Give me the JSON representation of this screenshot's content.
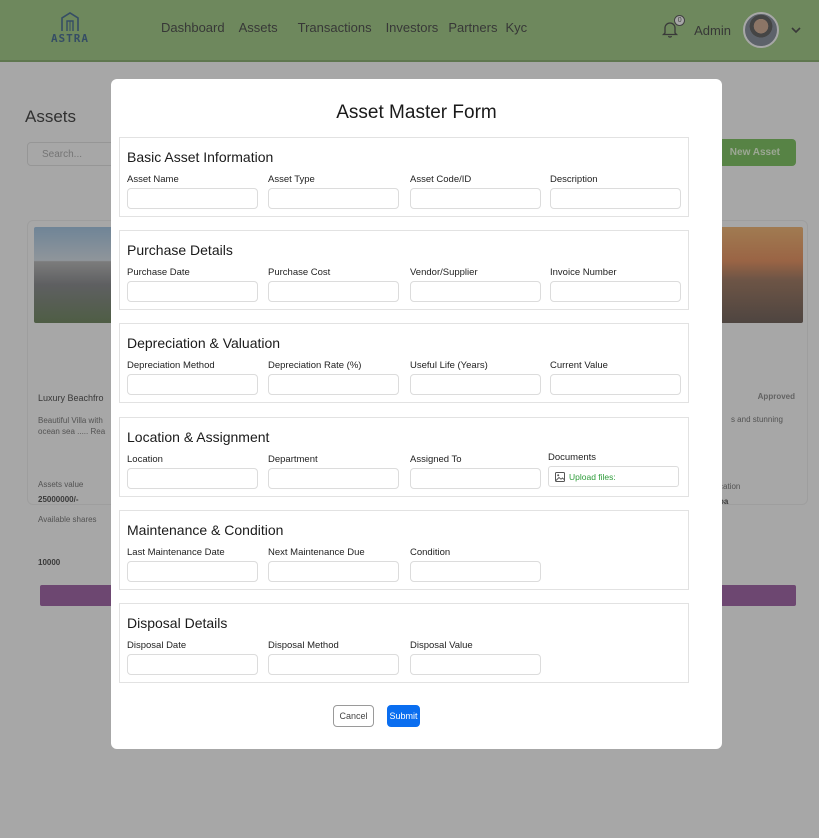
{
  "navbar": {
    "logo_text": "ASTRA",
    "links": [
      "Dashboard",
      "Assets",
      "Transactions",
      "Investors",
      "Partners",
      "Kyc"
    ],
    "notifications_badge": "0",
    "user_label": "Admin"
  },
  "page": {
    "title": "Assets",
    "search_placeholder": "Search...",
    "new_asset_label": "New Asset"
  },
  "background_cards": {
    "left": {
      "title": "Luxury Beachfro",
      "description": "Beautiful Villa with ocean sea ..... Rea",
      "assets_value_label": "Assets value",
      "assets_value": "25000000/-",
      "available_shares_label": "Available shares",
      "available_shares": "10000"
    },
    "right": {
      "status": "Approved",
      "description": "s and stunning",
      "location_label": "cation",
      "location_value": "oa"
    }
  },
  "modal": {
    "title": "Asset Master Form",
    "sections": [
      {
        "title": "Basic Asset Information",
        "fields": [
          "Asset Name",
          "Asset Type",
          "Asset Code/ID",
          "Description"
        ]
      },
      {
        "title": "Purchase Details",
        "fields": [
          "Purchase Date",
          "Purchase Cost",
          "Vendor/Supplier",
          "Invoice Number"
        ]
      },
      {
        "title": "Depreciation & Valuation",
        "fields": [
          "Depreciation Method",
          "Depreciation Rate (%)",
          "Useful Life (Years)",
          "Current Value"
        ]
      },
      {
        "title": "Location & Assignment",
        "fields": [
          "Location",
          "Department",
          "Assigned To"
        ],
        "documents_label": "Documents",
        "upload_label": "Upload files:"
      },
      {
        "title": "Maintenance & Condition",
        "fields": [
          "Last Maintenance Date",
          "Next Maintenance Due",
          "Condition"
        ]
      },
      {
        "title": "Disposal Details",
        "fields": [
          "Disposal Date",
          "Disposal Method",
          "Disposal Value"
        ]
      }
    ],
    "cancel_label": "Cancel",
    "submit_label": "Submit"
  },
  "colors": {
    "navbar": "#8cc06a",
    "new_asset_button": "#5fb63a",
    "submit_button": "#0a6ef0",
    "upload_text": "#2e9c3a",
    "purple_bar": "#8a3f92"
  }
}
